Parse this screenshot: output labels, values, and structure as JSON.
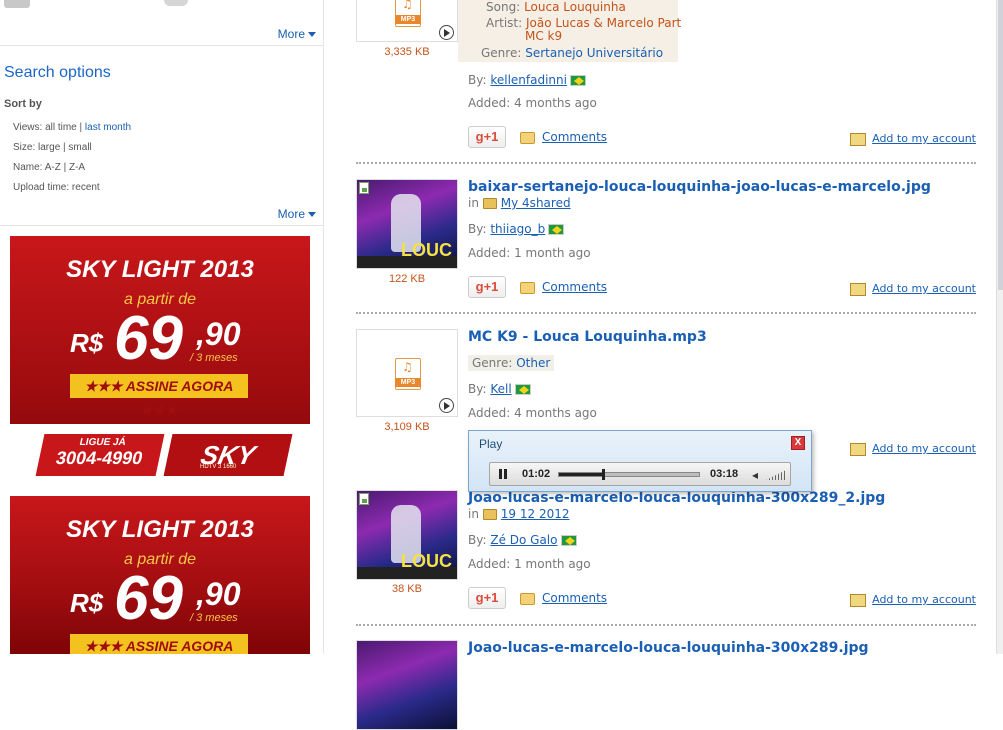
{
  "sidebar": {
    "more_label": "More",
    "search_options_title": "Search options",
    "sort_by_label": "Sort by",
    "options": [
      {
        "label": "Views:",
        "parts": [
          "all time",
          "last month"
        ]
      },
      {
        "label": "Size:",
        "parts": [
          "large",
          "small"
        ]
      },
      {
        "label": "Name:",
        "parts": [
          "A-Z",
          "Z-A"
        ]
      },
      {
        "label": "Upload time:",
        "parts": [
          "recent"
        ]
      }
    ]
  },
  "ads": [
    {
      "title": "SKY LIGHT 2013",
      "subtitle": "a partir de",
      "currency": "R$",
      "price_int": "69",
      "price_dec": ",90",
      "period": "/ 3 meses",
      "cta": "★★★ ASSINE AGORA ★★★",
      "ligue": "LIGUE JÁ",
      "phone": "3004-4990",
      "brand": "SKY",
      "brand_sub": "HDTV 3 1660"
    },
    {
      "title": "SKY LIGHT 2013",
      "subtitle": "a partir de",
      "currency": "R$",
      "price_int": "69",
      "price_dec": ",90",
      "period": "/ 3 meses",
      "cta": "★★★ ASSINE AGORA ★★★"
    }
  ],
  "results": [
    {
      "size": "3,335 KB",
      "type_label": "MP3",
      "song_label": "Song:",
      "song": "Louca Louquinha",
      "artist_label": "Artist:",
      "artist_l1": "João Lucas & Marcelo Part",
      "artist_l2": "MC k9",
      "genre_label": "Genre:",
      "genre": "Sertanejo Universitário",
      "by_label": "By:",
      "by": "kellenfadinni",
      "added_label": "Added:",
      "added": "4 months ago",
      "gplus": "+1",
      "comments": "Comments",
      "add": "Add to my account"
    },
    {
      "title": "baixar-sertanejo-louca-louquinha-joao-lucas-e-marcelo.jpg",
      "size": "122 KB",
      "in_label": "in",
      "folder": "My 4shared",
      "by_label": "By:",
      "by": "thiiago_b",
      "added_label": "Added:",
      "added": "1 month ago",
      "gplus": "+1",
      "comments": "Comments",
      "add": "Add to my account"
    },
    {
      "title": "MC K9 - Louca Louquinha.mp3",
      "size": "3,109 KB",
      "type_label": "MP3",
      "genre_label": "Genre:",
      "genre": "Other",
      "by_label": "By:",
      "by": "Kell",
      "added_label": "Added:",
      "added": "4 months ago",
      "add": "Add to my account"
    },
    {
      "title": "Joao-lucas-e-marcelo-louca-louquinha-300x289_2.jpg",
      "size": "38 KB",
      "in_label": "in",
      "folder": "19 12 2012",
      "by_label": "By:",
      "by": "Zé Do Galo",
      "added_label": "Added:",
      "added": "1 month ago",
      "gplus": "+1",
      "comments": "Comments",
      "add": "Add to my account"
    },
    {
      "title": "Joao-lucas-e-marcelo-louca-louquinha-300x289.jpg"
    }
  ],
  "player": {
    "title": "Play",
    "close": "X",
    "elapsed": "01:02",
    "duration": "03:18",
    "progress": 0.31
  }
}
